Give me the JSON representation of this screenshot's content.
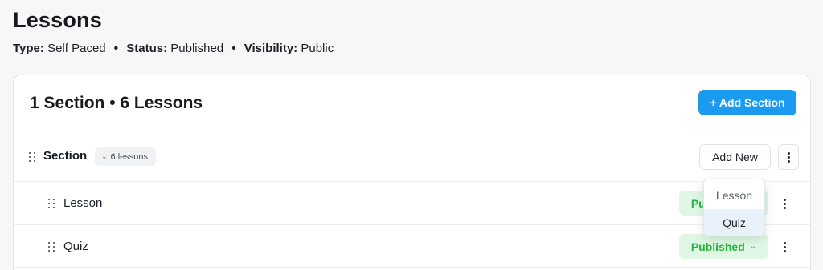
{
  "page": {
    "title": "Lessons",
    "meta": {
      "type_label": "Type:",
      "type_value": "Self Paced",
      "status_label": "Status:",
      "status_value": "Published",
      "visibility_label": "Visibility:",
      "visibility_value": "Public",
      "separator": "•"
    }
  },
  "card": {
    "title": "1 Section • 6 Lessons",
    "add_section_label": "+ Add Section"
  },
  "section": {
    "label": "Section",
    "count_badge": "6 lessons",
    "add_new_label": "Add New"
  },
  "items": [
    {
      "label": "Lesson",
      "status": "Published"
    },
    {
      "label": "Quiz",
      "status": "Published"
    }
  ],
  "dropdown": {
    "options": [
      "Lesson",
      "Quiz"
    ],
    "highlighted": "Quiz"
  },
  "colors": {
    "accent": "#1a9bf0",
    "published_text": "#27b53f",
    "published_bg": "#dff7e4",
    "dropdown_highlight": "#e9f1fb"
  },
  "icons": [
    "drag-handle-icon",
    "chevron-down-icon",
    "kebab-menu-icon"
  ]
}
